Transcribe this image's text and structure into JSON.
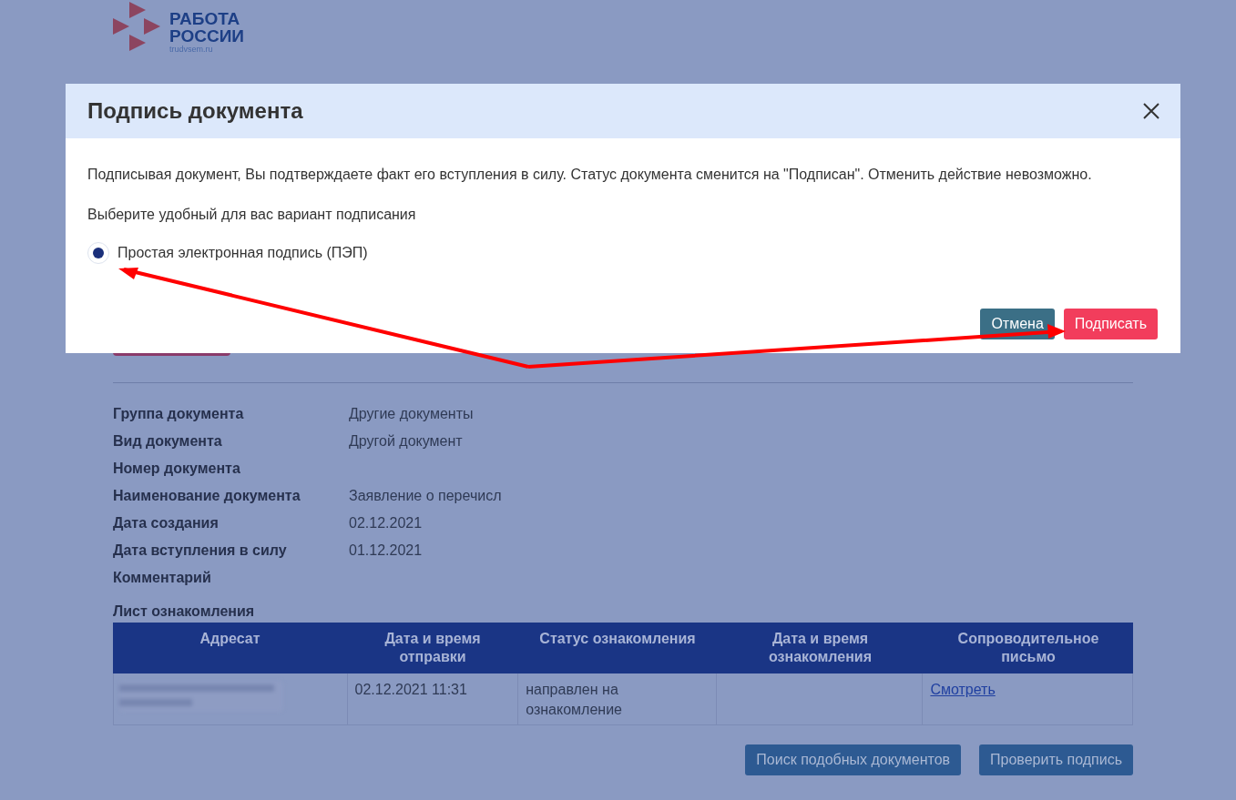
{
  "logo": {
    "line1": "РАБОТА",
    "line2": "РОССИИ",
    "domain": "trudvsem.ru"
  },
  "fields": [
    {
      "label": "Группа документа",
      "value": "Другие документы"
    },
    {
      "label": "Вид документа",
      "value": "Другой документ"
    },
    {
      "label": "Номер документа"
    },
    {
      "label": "Наименование документа",
      "value": "Заявление о перечисл"
    },
    {
      "label": "Дата создания",
      "value": "02.12.2021"
    },
    {
      "label": "Дата вступления в силу",
      "value": "01.12.2021"
    },
    {
      "label": "Комментарий"
    }
  ],
  "acquaintance": {
    "title": "Лист ознакомления",
    "columns": [
      "Адресат",
      "Дата и время отправки",
      "Статус ознакомления",
      "Дата и время ознакомления",
      "Сопроводительное письмо"
    ],
    "rows": [
      {
        "addressee_redacted": true,
        "sent": "02.12.2021 11:31",
        "status": "направлен на ознакомление",
        "letter": "Смотреть"
      }
    ]
  },
  "actions": [
    "Поиск подобных документов",
    "Проверить подпись"
  ],
  "modal": {
    "title": "Подпись документа",
    "text": "Подписывая документ, Вы подтверждаете факт его вступления в силу. Статус документа сменится на \"Подписан\". Отменить действие невозможно.",
    "prompt": "Выберите удобный для вас вариант подписания",
    "options": [
      {
        "label": "Простая электронная подпись (ПЭП)",
        "selected": true
      }
    ],
    "buttons": [
      {
        "label": "Отмена",
        "kind": "cancel"
      },
      {
        "label": "Подписать",
        "kind": "primary"
      }
    ]
  }
}
